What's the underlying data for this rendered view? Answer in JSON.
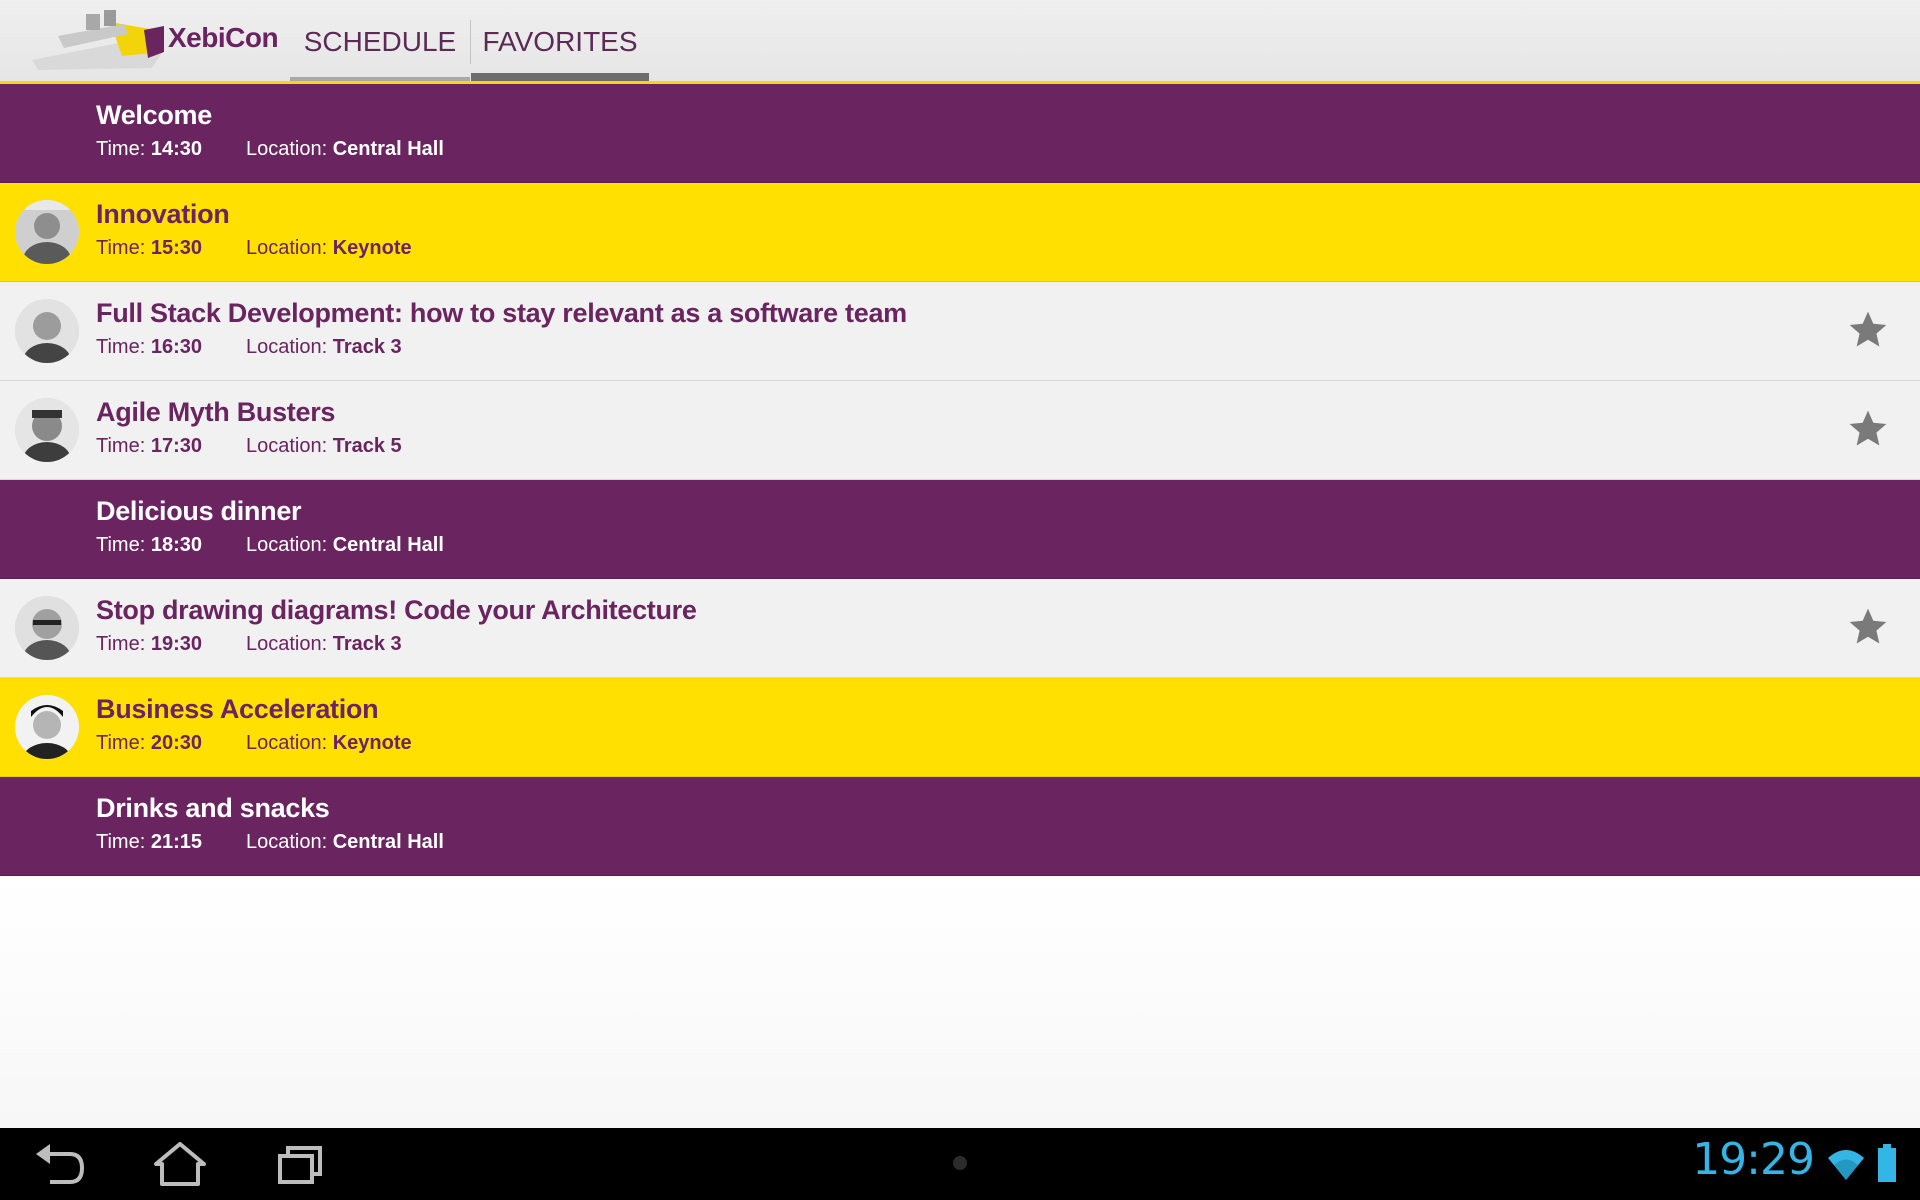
{
  "app": {
    "title": "XebiCon",
    "tabs": [
      {
        "label": "SCHEDULE",
        "active": false
      },
      {
        "label": "FAVORITES",
        "active": true
      }
    ]
  },
  "labels": {
    "time": "Time:",
    "location": "Location:"
  },
  "sessions": [
    {
      "title": "Welcome",
      "time": "14:30",
      "location": "Central Hall",
      "style": "purple",
      "speaker": false,
      "favorite": false
    },
    {
      "title": "Innovation",
      "time": "15:30",
      "location": "Keynote",
      "style": "yellow",
      "speaker": true,
      "favorite": false
    },
    {
      "title": "Full Stack Development: how to stay relevant as a software team",
      "time": "16:30",
      "location": "Track 3",
      "style": "grey",
      "speaker": true,
      "favorite": true
    },
    {
      "title": "Agile Myth Busters",
      "time": "17:30",
      "location": "Track 5",
      "style": "grey",
      "speaker": true,
      "favorite": true
    },
    {
      "title": "Delicious dinner",
      "time": "18:30",
      "location": "Central Hall",
      "style": "purple",
      "speaker": false,
      "favorite": false
    },
    {
      "title": "Stop drawing diagrams! Code your Architecture",
      "time": "19:30",
      "location": "Track 3",
      "style": "grey",
      "speaker": true,
      "favorite": true
    },
    {
      "title": "Business Acceleration",
      "time": "20:30",
      "location": "Keynote",
      "style": "yellow",
      "speaker": true,
      "favorite": false
    },
    {
      "title": "Drinks and snacks",
      "time": "21:15",
      "location": "Central Hall",
      "style": "purple",
      "speaker": false,
      "favorite": false
    }
  ],
  "statusbar": {
    "clock": "19:29"
  },
  "colors": {
    "purple": "#6a2460",
    "yellow": "#ffe000",
    "grey": "#f1f1f1",
    "clock": "#33b5e5",
    "star": "#7a7a7a"
  },
  "icons": {
    "back": "back-icon",
    "home": "home-icon",
    "recent": "recent-apps-icon",
    "wifi": "wifi-icon",
    "battery": "battery-icon",
    "star": "star-icon"
  }
}
